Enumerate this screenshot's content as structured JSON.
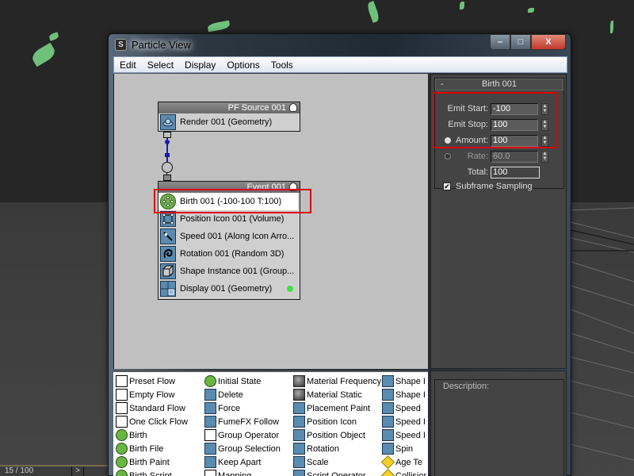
{
  "window": {
    "title": "Particle View",
    "app_icon": "3dsmax-icon",
    "controls": {
      "minimize": "–",
      "maximize": "□",
      "close": "X"
    }
  },
  "menubar": [
    "Edit",
    "Select",
    "Display",
    "Options",
    "Tools"
  ],
  "graph": {
    "source_node": {
      "title": "PF Source 001",
      "operators": [
        {
          "label": "Render 001 (Geometry)",
          "icon": "render-icon"
        }
      ]
    },
    "event_node": {
      "title": "Event 001",
      "operators": [
        {
          "label": "Birth 001 (-100-100 T:100)",
          "icon": "birth-icon",
          "selected": true
        },
        {
          "label": "Position Icon 001 (Volume)",
          "icon": "position-icon"
        },
        {
          "label": "Speed 001 (Along Icon Arro...",
          "icon": "speed-icon"
        },
        {
          "label": "Rotation 001 (Random 3D)",
          "icon": "rotation-icon"
        },
        {
          "label": "Shape Instance 001 (Group...",
          "icon": "shape-instance-icon"
        },
        {
          "label": "Display 001 (Geometry)",
          "icon": "display-icon",
          "status": "green"
        }
      ]
    }
  },
  "params": {
    "rollout_title": "Birth 001",
    "collapse": "-",
    "emit_start_label": "Emit Start:",
    "emit_start": "-100",
    "emit_stop_label": "Emit Stop:",
    "emit_stop": "100",
    "amount_label": "Amount:",
    "amount": "100",
    "rate_label": "Rate:",
    "rate": "60.0",
    "total_label": "Total:",
    "total": "100",
    "subframe_label": "Subframe Sampling",
    "subframe_checked": true,
    "amount_selected": true
  },
  "depot": {
    "columns": [
      [
        {
          "label": "Preset Flow",
          "icon": "flow"
        },
        {
          "label": "Empty Flow",
          "icon": "flow"
        },
        {
          "label": "Standard Flow",
          "icon": "flow"
        },
        {
          "label": "One Click Flow",
          "icon": "flow"
        },
        {
          "label": "Birth",
          "icon": "green"
        },
        {
          "label": "Birth File",
          "icon": "green"
        },
        {
          "label": "Birth Paint",
          "icon": "green"
        },
        {
          "label": "Birth Script",
          "icon": "green"
        }
      ],
      [
        {
          "label": "Initial State",
          "icon": "green"
        },
        {
          "label": "Delete",
          "icon": "blue"
        },
        {
          "label": "Force",
          "icon": "blue"
        },
        {
          "label": "FumeFX Follow",
          "icon": "blue"
        },
        {
          "label": "Group Operator",
          "icon": "white"
        },
        {
          "label": "Group Selection",
          "icon": "blue"
        },
        {
          "label": "Keep Apart",
          "icon": "blue"
        },
        {
          "label": "Mapping",
          "icon": "white"
        }
      ],
      [
        {
          "label": "Material Frequency",
          "icon": "gray"
        },
        {
          "label": "Material Static",
          "icon": "gray"
        },
        {
          "label": "Placement Paint",
          "icon": "blue"
        },
        {
          "label": "Position Icon",
          "icon": "blue"
        },
        {
          "label": "Position Object",
          "icon": "blue"
        },
        {
          "label": "Rotation",
          "icon": "blue"
        },
        {
          "label": "Scale",
          "icon": "blue"
        },
        {
          "label": "Script Operator",
          "icon": "blue"
        }
      ],
      [
        {
          "label": "Shape I",
          "icon": "blue"
        },
        {
          "label": "Shape I",
          "icon": "blue"
        },
        {
          "label": "Speed",
          "icon": "blue"
        },
        {
          "label": "Speed I",
          "icon": "blue"
        },
        {
          "label": "Speed I",
          "icon": "blue"
        },
        {
          "label": "Spin",
          "icon": "blue"
        },
        {
          "label": "Age Te",
          "icon": "yellow"
        },
        {
          "label": "Collisior",
          "icon": "yellow"
        }
      ]
    ]
  },
  "description": {
    "label": "Description:"
  },
  "timeline": {
    "frame": "15 / 100",
    "next": ">"
  },
  "colors": {
    "highlight": "#e00000",
    "status_green": "#3fe03f"
  }
}
